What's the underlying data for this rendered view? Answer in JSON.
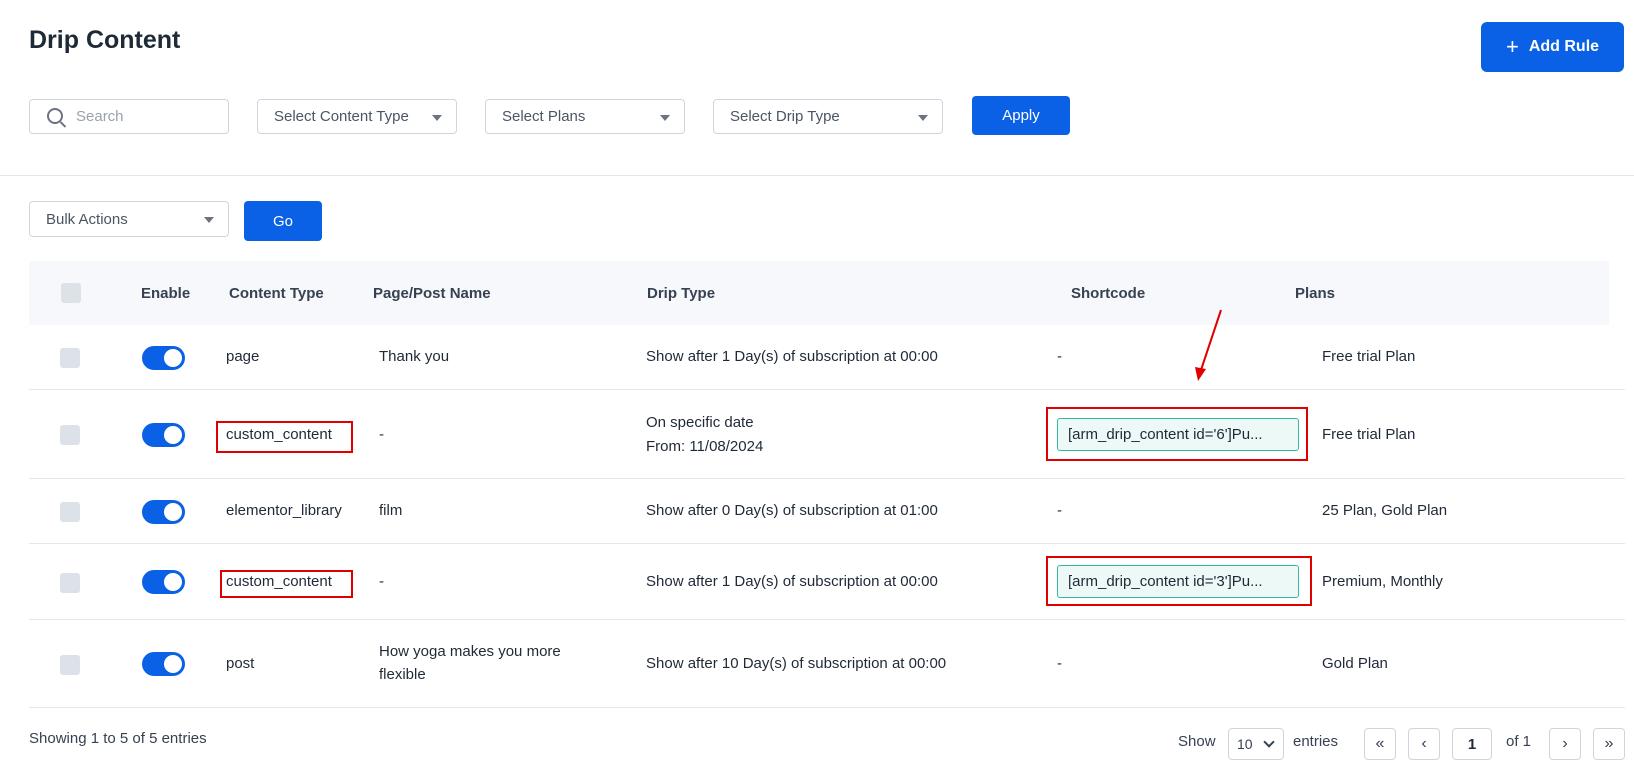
{
  "page": {
    "title": "Drip Content"
  },
  "header": {
    "add_rule_label": "Add Rule",
    "add_rule_icon": "plus-icon"
  },
  "filters": {
    "search_placeholder": "Search",
    "content_type": "Select Content Type",
    "plans": "Select Plans",
    "drip_type": "Select Drip Type",
    "apply_label": "Apply"
  },
  "bulk": {
    "selected": "Bulk Actions",
    "go_label": "Go"
  },
  "table": {
    "headers": {
      "enable": "Enable",
      "content_type": "Content Type",
      "page_post_name": "Page/Post Name",
      "drip_type": "Drip Type",
      "shortcode": "Shortcode",
      "plans": "Plans"
    },
    "rows": [
      {
        "enabled": true,
        "content_type": "page",
        "name": "Thank you",
        "drip_line1": "Show after 1 Day(s) of subscription at 00:00",
        "drip_line2": "",
        "shortcode": "-",
        "plans": "Free trial Plan"
      },
      {
        "enabled": true,
        "content_type": "custom_content",
        "name": "-",
        "drip_line1": "On specific date",
        "drip_line2": "From: 11/08/2024",
        "shortcode": "[arm_drip_content id='6']Pu...",
        "plans": "Free trial Plan"
      },
      {
        "enabled": true,
        "content_type": "elementor_library",
        "name": "film",
        "drip_line1": "Show after 0 Day(s) of subscription at 01:00",
        "drip_line2": "",
        "shortcode": "-",
        "plans": "25 Plan, Gold Plan"
      },
      {
        "enabled": true,
        "content_type": "custom_content",
        "name": "-",
        "drip_line1": "Show after 1 Day(s) of subscription at 00:00",
        "drip_line2": "",
        "shortcode": "[arm_drip_content id='3']Pu...",
        "plans": "Premium, Monthly"
      },
      {
        "enabled": true,
        "content_type": "post",
        "name_line1": "How yoga makes you more",
        "name_line2": "flexible",
        "drip_line1": "Show after 10 Day(s) of subscription at 00:00",
        "drip_line2": "",
        "shortcode": "-",
        "plans": "Gold Plan"
      }
    ]
  },
  "footer": {
    "showing": "Showing 1 to 5 of 5 entries",
    "show_label": "Show",
    "per_page": "10",
    "entries_label": "entries",
    "current_page": "1",
    "of_label": "of 1",
    "first": "«",
    "prev": "‹",
    "next": "›",
    "last": "»"
  },
  "colors": {
    "primary": "#0a61e6",
    "highlight": "#e00000",
    "shortcode_bg": "#edf9f7"
  }
}
